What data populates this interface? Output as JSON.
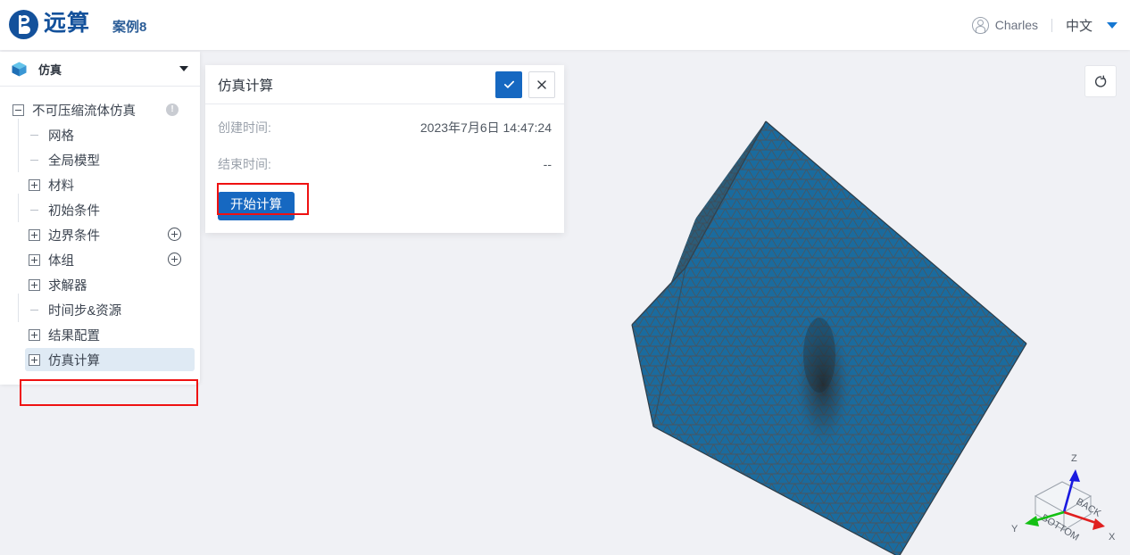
{
  "topbar": {
    "brand_name": "远算",
    "case_title": "案例8",
    "user_name": "Charles",
    "language": "中文",
    "avatar_icon": "user-circle-icon",
    "caret_icon": "chevron-down-icon"
  },
  "sidebar": {
    "header_label": "仿真",
    "header_icon": "cube-icon",
    "collapse_icon": "chevron-down-icon",
    "tree": [
      {
        "label": "不可压缩流体仿真",
        "toggle": "minus",
        "level": 0,
        "badge": "warning-icon",
        "badge_char": "!",
        "selected": false
      },
      {
        "label": "网格",
        "toggle": "dash",
        "level": 1,
        "badge": null,
        "selected": false
      },
      {
        "label": "全局模型",
        "toggle": "dash",
        "level": 1,
        "badge": null,
        "selected": false
      },
      {
        "label": "材料",
        "toggle": "plus",
        "level": 1,
        "badge": null,
        "selected": false
      },
      {
        "label": "初始条件",
        "toggle": "dash",
        "level": 1,
        "badge": null,
        "selected": false
      },
      {
        "label": "边界条件",
        "toggle": "plus",
        "level": 1,
        "badge": "add-circle-icon",
        "selected": false
      },
      {
        "label": "体组",
        "toggle": "plus",
        "level": 1,
        "badge": "add-circle-icon",
        "selected": false
      },
      {
        "label": "求解器",
        "toggle": "plus",
        "level": 1,
        "badge": null,
        "selected": false
      },
      {
        "label": "时间步&资源",
        "toggle": "dash",
        "level": 1,
        "badge": null,
        "selected": false
      },
      {
        "label": "结果配置",
        "toggle": "plus",
        "level": 1,
        "badge": null,
        "selected": false
      },
      {
        "label": "仿真计算",
        "toggle": "plus",
        "level": 1,
        "badge": null,
        "selected": true
      }
    ]
  },
  "dialog": {
    "title": "仿真计算",
    "confirm_icon": "check-icon",
    "cancel_icon": "close-icon",
    "rows": [
      {
        "label": "创建时间:",
        "value": "2023年7月6日 14:47:24"
      },
      {
        "label": "结束时间:",
        "value": "--"
      }
    ],
    "start_button": "开始计算"
  },
  "viewport": {
    "reset_icon": "rotate-reset-icon",
    "axis": {
      "x_label": "X",
      "y_label": "Y",
      "z_label": "Z",
      "x_color": "#e02020",
      "y_color": "#14c014",
      "z_color": "#1a1ae0",
      "face_back": "BACK",
      "face_bottom": "BOTTOM"
    },
    "model": {
      "mesh_fill": "#1a6b9e",
      "mesh_line": "#4a5560",
      "shade_fill": "#2d5d78",
      "background": "#f0f1f5"
    }
  },
  "annotations": {
    "highlight_color": "#ef1111",
    "boxes": [
      "tree-item-simulation-run",
      "start-calculation-button"
    ]
  }
}
